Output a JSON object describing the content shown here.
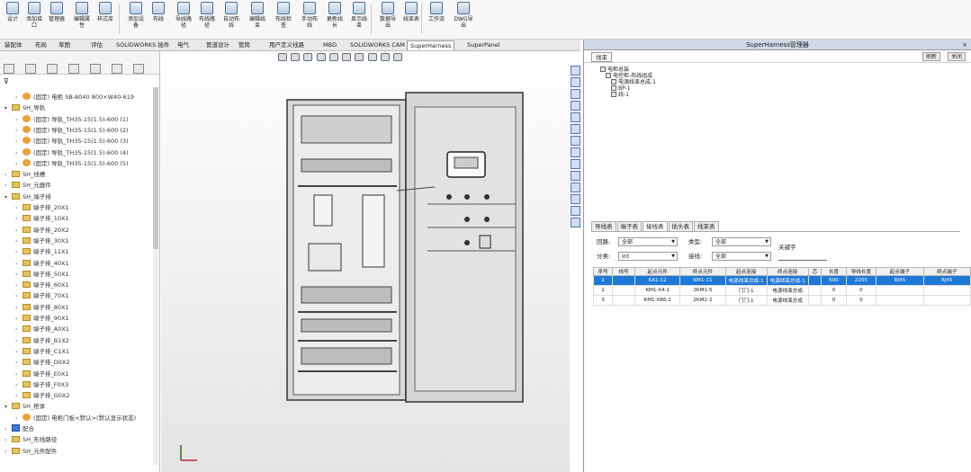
{
  "ribbon": {
    "buttons": [
      {
        "label": "设计",
        "icon": "design-icon"
      },
      {
        "label": "添加接口",
        "icon": "add-connector-icon"
      },
      {
        "label": "管理器",
        "icon": "manager-icon"
      },
      {
        "label": "编辑属性",
        "icon": "edit-props-icon"
      },
      {
        "label": "样式库",
        "icon": "style-lib-icon"
      },
      {
        "label": "添加设备",
        "icon": "add-device-icon"
      },
      {
        "label": "布线",
        "icon": "route-icon"
      },
      {
        "label": "导线路径",
        "icon": "wire-path-icon"
      },
      {
        "label": "布线路径",
        "icon": "route-path-icon"
      },
      {
        "label": "自动布线",
        "icon": "auto-route-icon"
      },
      {
        "label": "编辑线束",
        "icon": "edit-harness-icon"
      },
      {
        "label": "布线检查",
        "icon": "route-check-icon"
      },
      {
        "label": "手动布线",
        "icon": "manual-route-icon"
      },
      {
        "label": "更新线长",
        "icon": "update-length-icon"
      },
      {
        "label": "显示线束",
        "icon": "show-harness-icon"
      },
      {
        "label": "数据导出",
        "icon": "export-icon"
      },
      {
        "label": "线束表",
        "icon": "harness-table-icon"
      },
      {
        "label": "工作流",
        "icon": "workflow-icon"
      },
      {
        "label": "DWG导出",
        "icon": "dwg-export-icon"
      }
    ]
  },
  "doc_tabs": [
    "装配体",
    "布局",
    "草图",
    "评估",
    "SOLIDWORKS 插件",
    "电气",
    "管道设计",
    "管筒",
    "用户定义线路",
    "MBD",
    "SOLIDWORKS CAM",
    "SuperHarness",
    "SuperPanel"
  ],
  "tree": [
    {
      "label": "(固定) 电柜 SB-8040 800×W40-619",
      "indent": 1,
      "icon": "gear"
    },
    {
      "label": "SH_导轨",
      "indent": 0,
      "icon": "fold",
      "open": true
    },
    {
      "label": "(固定) 导轨_TH35-15(1.5)-600 (1)",
      "indent": 1,
      "icon": "gear"
    },
    {
      "label": "(固定) 导轨_TH35-15(1.5)-600 (2)",
      "indent": 1,
      "icon": "gear"
    },
    {
      "label": "(固定) 导轨_TH35-15(1.5)-600 (3)",
      "indent": 1,
      "icon": "gear"
    },
    {
      "label": "(固定) 导轨_TH35-15(1.5)-600 (4)",
      "indent": 1,
      "icon": "gear"
    },
    {
      "label": "(固定) 导轨_TH35-15(1.5)-600 (5)",
      "indent": 1,
      "icon": "gear"
    },
    {
      "label": "SH_线槽",
      "indent": 0,
      "icon": "fold"
    },
    {
      "label": "SH_元器件",
      "indent": 0,
      "icon": "fold"
    },
    {
      "label": "SH_端子排",
      "indent": 0,
      "icon": "fold",
      "open": true
    },
    {
      "label": "端子排_20X1",
      "indent": 1,
      "icon": "fold"
    },
    {
      "label": "端子排_10X1",
      "indent": 1,
      "icon": "fold"
    },
    {
      "label": "端子排_20X2",
      "indent": 1,
      "icon": "fold"
    },
    {
      "label": "端子排_30X1",
      "indent": 1,
      "icon": "fold"
    },
    {
      "label": "端子排_11X1",
      "indent": 1,
      "icon": "fold"
    },
    {
      "label": "端子排_40X1",
      "indent": 1,
      "icon": "fold"
    },
    {
      "label": "端子排_50X1",
      "indent": 1,
      "icon": "fold"
    },
    {
      "label": "端子排_60X1",
      "indent": 1,
      "icon": "fold"
    },
    {
      "label": "端子排_70X1",
      "indent": 1,
      "icon": "fold"
    },
    {
      "label": "端子排_80X1",
      "indent": 1,
      "icon": "fold"
    },
    {
      "label": "端子排_90X1",
      "indent": 1,
      "icon": "fold"
    },
    {
      "label": "端子排_A0X1",
      "indent": 1,
      "icon": "fold"
    },
    {
      "label": "端子排_B1X2",
      "indent": 1,
      "icon": "fold"
    },
    {
      "label": "端子排_C1X1",
      "indent": 1,
      "icon": "fold"
    },
    {
      "label": "端子排_D0X2",
      "indent": 1,
      "icon": "fold"
    },
    {
      "label": "端子排_E0X1",
      "indent": 1,
      "icon": "fold"
    },
    {
      "label": "端子排_F0X3",
      "indent": 1,
      "icon": "fold"
    },
    {
      "label": "端子排_G0X2",
      "indent": 1,
      "icon": "fold"
    },
    {
      "label": "SH_柜体",
      "indent": 0,
      "icon": "fold",
      "open": true
    },
    {
      "label": "(固定) 电柜门板<默认>(默认显示状态)",
      "indent": 1,
      "icon": "gear"
    },
    {
      "label": "配合",
      "indent": 0,
      "icon": "part"
    },
    {
      "label": "SH_布线路径",
      "indent": 0,
      "icon": "fold"
    },
    {
      "label": "SH_元件配件",
      "indent": 0,
      "icon": "fold"
    }
  ],
  "superharness": {
    "title": "SuperHarness管理器",
    "close": "×",
    "tab": "线束",
    "btn1": "刷新",
    "btn2": "关闭",
    "tree": [
      "电柜总装",
      "电控柜-布线组成",
      "电源线束总成-1",
      "BP-1",
      "线-1"
    ]
  },
  "wire_tabs": [
    "导线表",
    "端子表",
    "接线表",
    "插头表",
    "线束表"
  ],
  "wire_tab_active": 2,
  "filters": {
    "l1": "回路:",
    "v1": "全部",
    "l2": "类型:",
    "v2": "全部",
    "l3": "分类:",
    "v3": "Int",
    "l4": "接线:",
    "v4": "全部",
    "l5": "关键字"
  },
  "table": {
    "headers": [
      "序号",
      "线号",
      "起点元件",
      "终点元件",
      "起点连接",
      "终点连接",
      "芯",
      "长度",
      "导线长度",
      "起点端子",
      "终点端子"
    ],
    "rows": [
      [
        "1",
        "",
        "KA1-12",
        "KM1-11",
        "电源线束总成-1",
        "电源线束总成-1",
        "",
        "600",
        "2205",
        "RJ45",
        "RJ45"
      ],
      [
        "2",
        "",
        "KM1-X4-1",
        "2KM1-5",
        "门门-1",
        "电源线束总成",
        "",
        "0",
        "0",
        "",
        ""
      ],
      [
        "3",
        "",
        "KM1-X86-2",
        "2KM2-2",
        "门门-1",
        "电源线束总成",
        "",
        "0",
        "0",
        "",
        ""
      ]
    ]
  }
}
